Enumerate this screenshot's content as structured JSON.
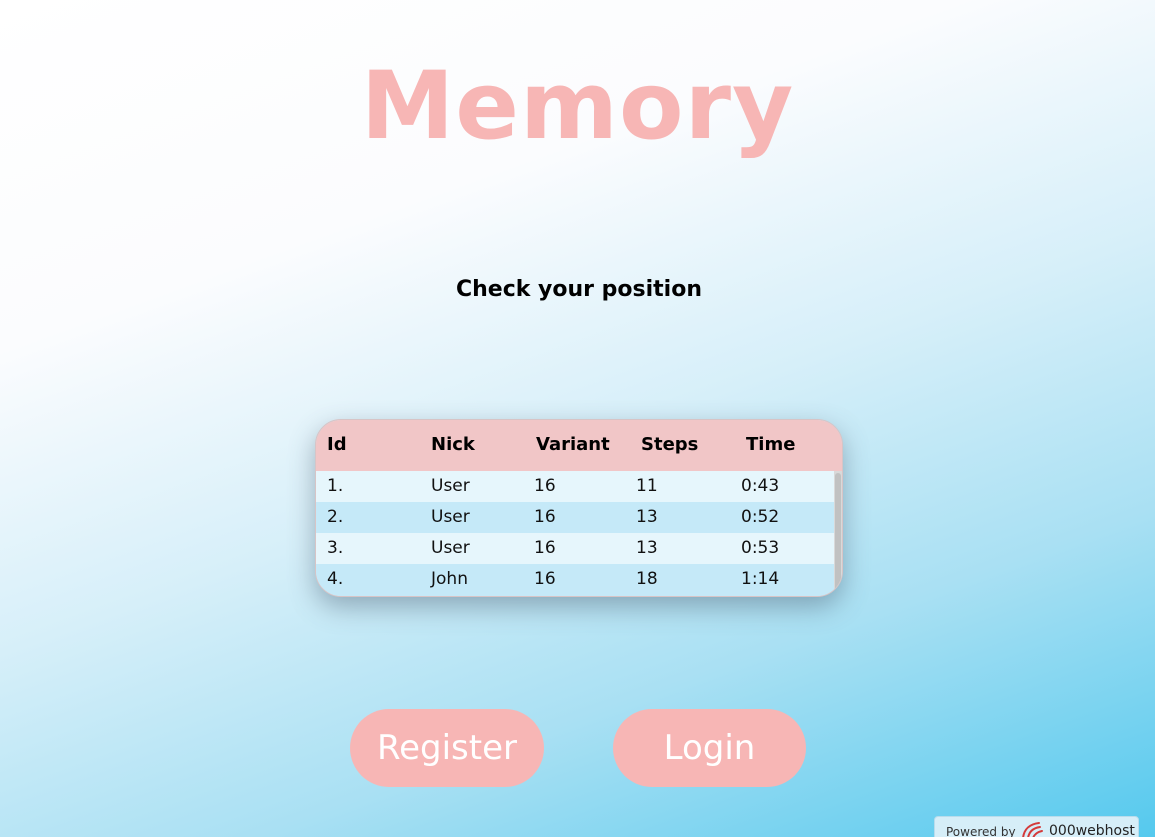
{
  "title": "Memory",
  "subtitle": "Check your position",
  "table": {
    "headers": [
      "Id",
      "Nick",
      "Variant",
      "Steps",
      "Time"
    ],
    "rows": [
      [
        "1.",
        "User",
        "16",
        "11",
        "0:43"
      ],
      [
        "2.",
        "User",
        "16",
        "13",
        "0:52"
      ],
      [
        "3.",
        "User",
        "16",
        "13",
        "0:53"
      ],
      [
        "4.",
        "John",
        "16",
        "18",
        "1:14"
      ]
    ]
  },
  "buttons": {
    "register": "Register",
    "login": "Login"
  },
  "footer": {
    "powered_by": "Powered by",
    "brand": "000webhost",
    "logo_icon": "000webhost-logo-icon"
  },
  "colors": {
    "accent_pink": "#f7b6b5",
    "header_pink": "#f1c6c7",
    "row_light": "#e6f6fc",
    "row_dark": "#c5e9f8"
  }
}
